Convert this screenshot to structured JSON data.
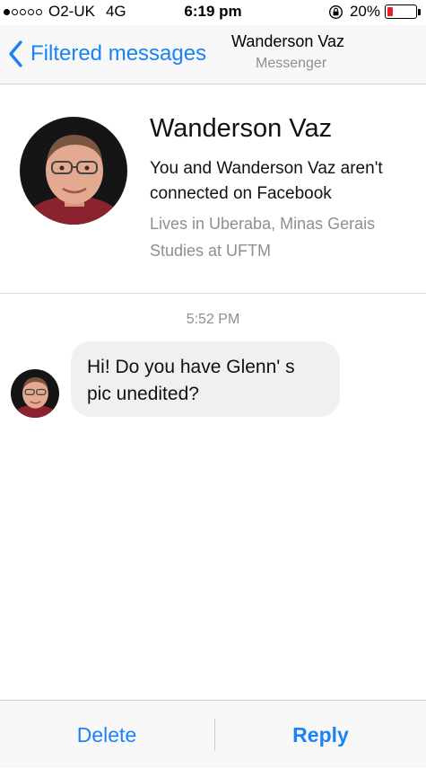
{
  "status_bar": {
    "carrier": "O2-UK",
    "network": "4G",
    "time": "6:19 pm",
    "battery": "20%",
    "battery_level": 0.2,
    "signal_bars_filled": 1,
    "signal_bars_total": 5
  },
  "nav": {
    "back_label": "Filtered messages",
    "title": "Wanderson Vaz",
    "subtitle": "Messenger",
    "accent_color": "#1a82f7"
  },
  "profile": {
    "name": "Wanderson Vaz",
    "connection_line1": "You and Wanderson Vaz aren't",
    "connection_line2": "connected on Facebook",
    "lives": "Lives in Uberaba, Minas Gerais",
    "studies": "Studies at UFTM"
  },
  "conversation": {
    "timestamp": "5:52 PM",
    "messages": [
      {
        "line1": "Hi! Do you have Glenn' s",
        "line2": "pic unedited?"
      }
    ]
  },
  "toolbar": {
    "delete_label": "Delete",
    "reply_label": "Reply"
  }
}
